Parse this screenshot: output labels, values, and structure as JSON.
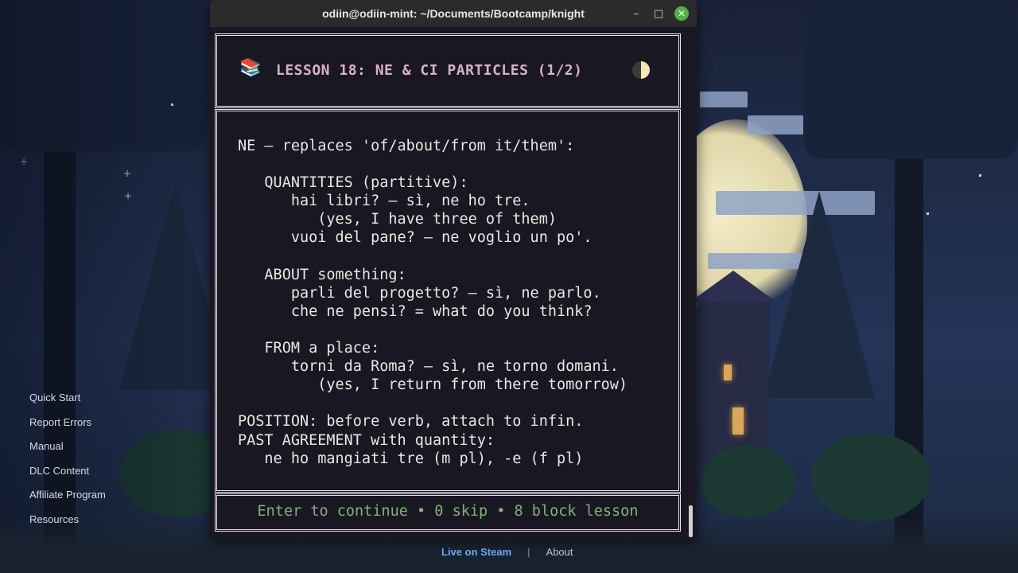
{
  "window": {
    "title": "odiin@odiin-mint: ~/Documents/Bootcamp/knight",
    "minimize_glyph": "–",
    "maximize_glyph": "□",
    "close_glyph": "✕"
  },
  "lesson": {
    "icon": "📚",
    "title": "LESSON 18: NE & CI PARTICLES (1/2)",
    "lines": [
      "NE – replaces 'of/about/from it/them':",
      "",
      "   QUANTITIES (partitive):",
      "      hai libri? – sì, ne ho tre.",
      "         (yes, I have three of them)",
      "      vuoi del pane? – ne voglio un po'.",
      "",
      "   ABOUT something:",
      "      parli del progetto? – sì, ne parlo.",
      "      che ne pensi? = what do you think?",
      "",
      "   FROM a place:",
      "      torni da Roma? – sì, ne torno domani.",
      "         (yes, I return from there tomorrow)",
      "",
      "POSITION: before verb, attach to infin.",
      "PAST AGREEMENT with quantity:",
      "   ne ho mangiati tre (m pl), -e (f pl)"
    ],
    "footer": "Enter to continue • 0 skip • 8 block lesson"
  },
  "side_menu": [
    "Quick Start",
    "Report Errors",
    "Manual",
    "DLC Content",
    "Affiliate Program",
    "Resources"
  ],
  "bottom_links": {
    "steam": "Live on Steam",
    "separator": "|",
    "about": "About"
  },
  "icons": [
    "books-icon",
    "half-moon-icon",
    "minimize-icon",
    "maximize-icon",
    "close-icon"
  ],
  "colors": {
    "accent_title": "#d8b0c6",
    "footer_text": "#7fb27a",
    "steam_link": "#6fb3ff",
    "close_button": "#4fb14a"
  }
}
